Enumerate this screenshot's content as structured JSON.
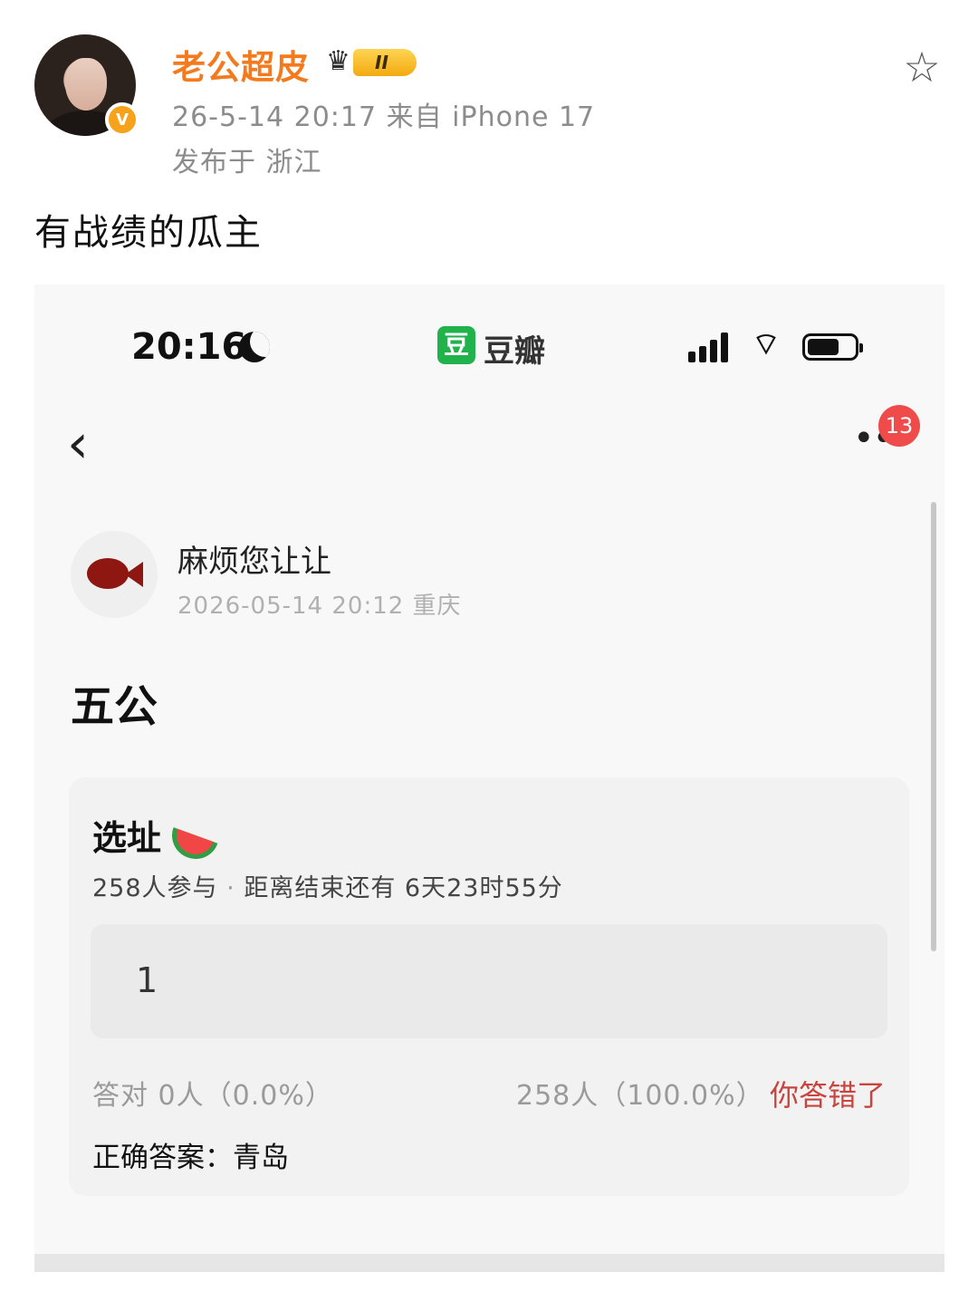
{
  "post": {
    "username": "老公超皮",
    "verified_badge": "V",
    "rank_badge": "II",
    "meta_time_source": "26-5-14 20:17  来自 iPhone 17",
    "meta_location": "发布于 浙江",
    "text": "有战绩的瓜主"
  },
  "screenshot": {
    "status_bar": {
      "time": "20:16",
      "app_icon_char": "豆",
      "app_name": "豆瓣"
    },
    "nav": {
      "back": "‹",
      "more": "•••",
      "notification_count": "13"
    },
    "author": {
      "name": "麻烦您让让",
      "meta": "2026-05-14 20:12  重庆"
    },
    "title": "五公",
    "quiz": {
      "title": "选址",
      "participants": "258人参与",
      "separator": "·",
      "countdown": "距离结束还有 6天23时55分",
      "answer": "1",
      "correct_stat": "答对  0人（0.0%）",
      "wrong_stat": "258人（100.0%）",
      "wrong_label": "你答错了",
      "correct_answer": "正确答案：青岛"
    }
  },
  "colors": {
    "username": "#f37a1d",
    "wrong": "#c8453f",
    "douban_green": "#22b24c",
    "badge_red": "#ef4b4b"
  },
  "icons": [
    "star-icon",
    "moon-icon",
    "signal-icon",
    "wifi-icon",
    "battery-icon",
    "back-chevron-icon",
    "more-dots-icon",
    "watermelon-icon"
  ]
}
